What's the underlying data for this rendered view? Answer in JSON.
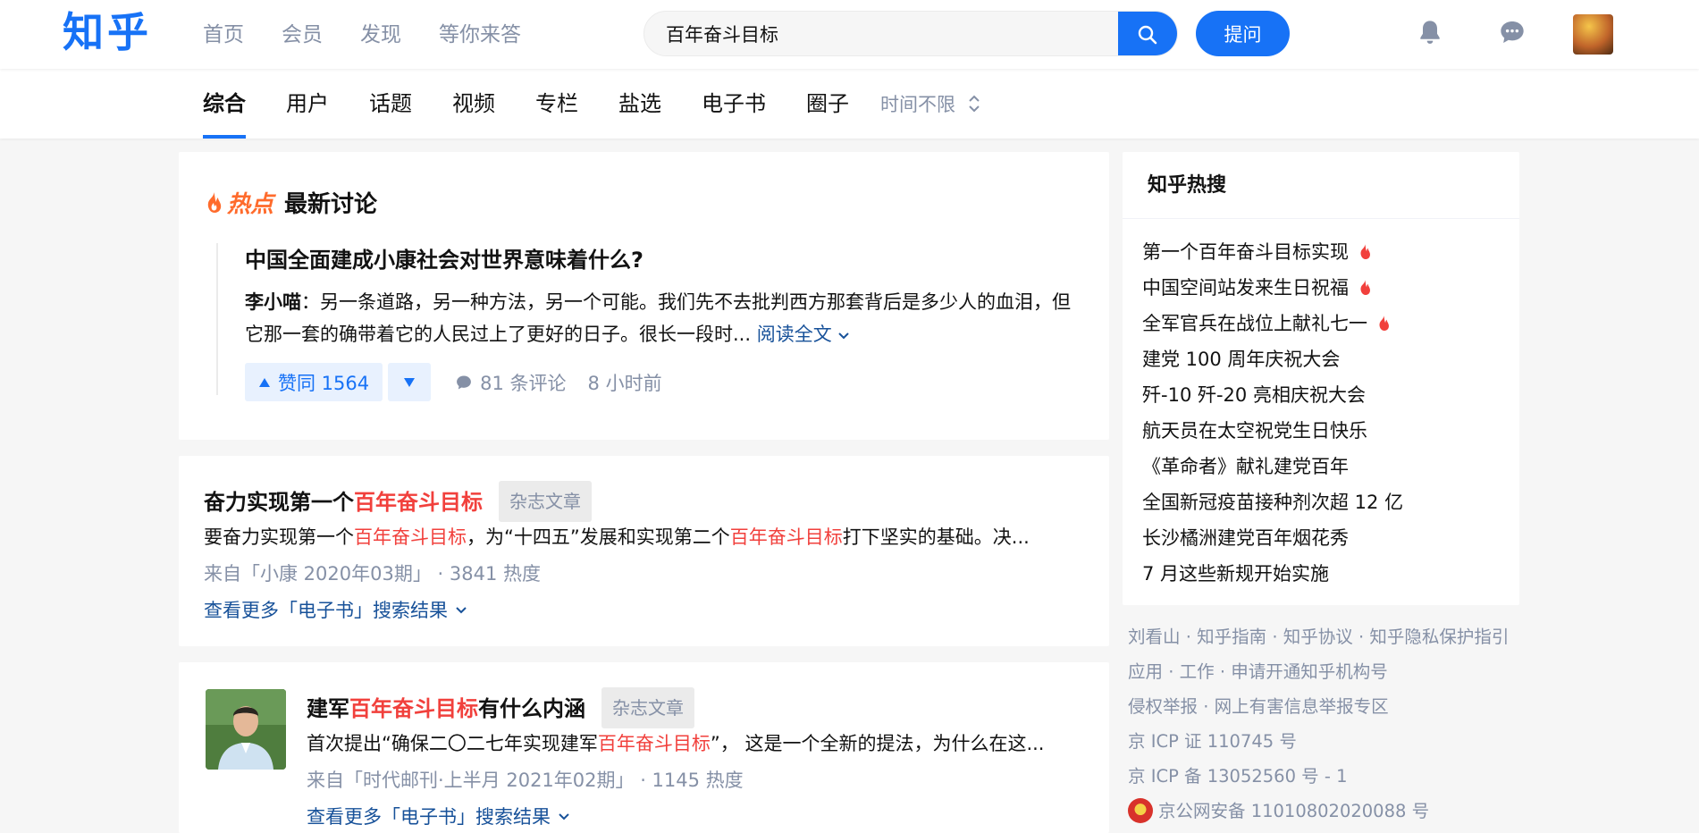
{
  "header": {
    "logo": "知乎",
    "nav": [
      "首页",
      "会员",
      "发现",
      "等你来答"
    ],
    "search_value": "百年奋斗目标",
    "ask_label": "提问"
  },
  "tabs": {
    "items": [
      "综合",
      "用户",
      "话题",
      "视频",
      "专栏",
      "盐选",
      "电子书",
      "圈子"
    ],
    "active": "综合",
    "time_filter": "时间不限"
  },
  "hot_card": {
    "tag": "热点",
    "title": "最新讨论",
    "question": "中国全面建成小康社会对世界意味着什么?",
    "author": "李小喵",
    "excerpt": "：另一条道路，另一种方法，另一个可能。我们先不去批判西方那套背后是多少人的血泪，但它那一套的确带着它的人民过上了更好的日子。很长一段时...",
    "read_more": "阅读全文",
    "upvote_label": "赞同 1564",
    "comments": "81 条评论",
    "time_ago": "8 小时前"
  },
  "articles": [
    {
      "title_prefix": "奋力实现第一个",
      "title_highlight": "百年奋斗目标",
      "title_suffix": "",
      "badge": "杂志文章",
      "excerpt_1": "要奋力实现第一个",
      "excerpt_hl_1": "百年奋斗目标",
      "excerpt_2": "，为“十四五”发展和实现第二个",
      "excerpt_hl_2": "百年奋斗目标",
      "excerpt_3": "打下坚实的基础。决...",
      "meta": "来自「小康 2020年03期」 · 3841 热度",
      "more": "查看更多「电子书」搜索结果"
    },
    {
      "title_prefix": "建军",
      "title_highlight": "百年奋斗目标",
      "title_suffix": "有什么内涵",
      "badge": "杂志文章",
      "excerpt_1": "首次提出“确保二〇二七年实现建军",
      "excerpt_hl_1": "百年奋斗目标",
      "excerpt_2": "”， 这是一个全新的提法，为什么在这...",
      "meta": "来自「时代邮刊·上半月 2021年02期」 · 1145 热度",
      "more": "查看更多「电子书」搜索结果"
    }
  ],
  "sidebar": {
    "title": "知乎热搜",
    "items": [
      {
        "text": "第一个百年奋斗目标实现",
        "hot": true
      },
      {
        "text": "中国空间站发来生日祝福",
        "hot": true
      },
      {
        "text": "全军官兵在战位上献礼七一",
        "hot": true
      },
      {
        "text": "建党 100 周年庆祝大会",
        "hot": false
      },
      {
        "text": "歼-10 歼-20 亮相庆祝大会",
        "hot": false
      },
      {
        "text": "航天员在太空祝党生日快乐",
        "hot": false
      },
      {
        "text": "《革命者》献礼建党百年",
        "hot": false
      },
      {
        "text": "全国新冠疫苗接种剂次超 12 亿",
        "hot": false
      },
      {
        "text": "长沙橘洲建党百年烟花秀",
        "hot": false
      },
      {
        "text": "7 月这些新规开始实施",
        "hot": false
      }
    ]
  },
  "footer": {
    "row1": [
      "刘看山",
      "知乎指南",
      "知乎协议",
      "知乎隐私保护指引"
    ],
    "row2": [
      "应用",
      "工作",
      "申请开通知乎机构号"
    ],
    "row3": [
      "侵权举报",
      "网上有害信息举报专区"
    ],
    "icp1": "京 ICP 证 110745 号",
    "icp2": "京 ICP 备 13052560 号 - 1",
    "police": "京公网安备 11010802020088 号",
    "sep": " · "
  },
  "colors": {
    "brand": "#1772f6",
    "highlight": "#f1403c",
    "hot": "#ff6b2c",
    "muted": "#8590a6"
  }
}
